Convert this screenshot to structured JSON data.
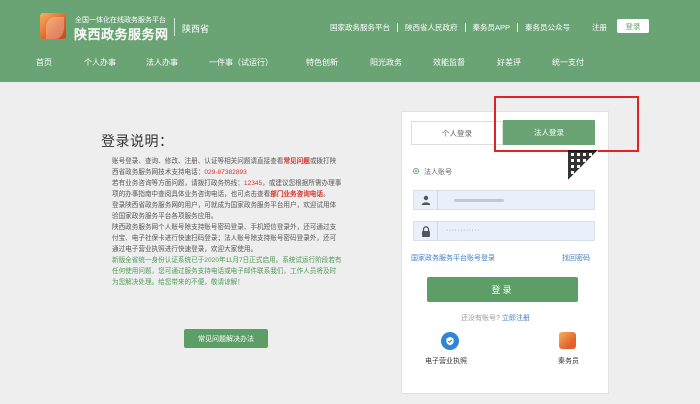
{
  "header": {
    "logo_small": "全国一体化在线政务服务平台",
    "logo_big": "陕西政务服务网",
    "province": "陕西省",
    "top_links": [
      "国家政务服务平台",
      "陕西省人民政府",
      "秦务员APP",
      "秦务员公众号"
    ],
    "register": "注册",
    "login": "登录",
    "brand_color": "#6aa374"
  },
  "nav": {
    "items": [
      "首页",
      "个人办事",
      "法人办事",
      "一件事（试运行）",
      "特色创新",
      "阳光政务",
      "效能监督",
      "好差评",
      "统一支付"
    ]
  },
  "intro": {
    "title": "登录说明：",
    "p1a": "账号登录、查询、修改、注册、认证等相关问题请直接查看",
    "p1b": "常见问题",
    "p1c": "或拨打陕西省政务服务网技术支持电话：",
    "p1d": "029-87382893",
    "p2a": "若有业务咨询等方面问题，请拨打政务热线：",
    "p2b": "12345",
    "p2c": "，或建议您根据所需办理事项的办事指南中查阅具体业务咨询电话，也可点击查看",
    "p2d": "部门业务咨询电话",
    "p2e": "。",
    "p3": "登录陕西省政务服务网的用户，可就成为国家政务服务平台用户，欢迎试用体验国家政务服务平台各项服务应用。",
    "p4": "陕西政务服务网个人账号除支持账号密码登录、手机短信登录外，还可通过支付宝、电子社保卡进行快速扫码登录；法人账号除支持账号密码登录外，还可通过电子营业执照进行快速登录，欢迎大家使用。",
    "p5": "新版全省统一身份认证系统已于2020年11月7日正式启用。系统试运行阶段若有任何使用问题，您可通过服务支持电话或电子邮件联系我们，工作人员将及时为您解决处理。给您带来的不便，敬请谅解！",
    "faq_button": "常见问题解决办法"
  },
  "login": {
    "tab_personal": "个人登录",
    "tab_legal": "法人登录",
    "radio_label": "法人账号",
    "account_value": "··········",
    "password_value": "············",
    "link_platform": "国家政务服务平台账号登录",
    "link_forgot": "找回密码",
    "submit": "登录",
    "no_account": "还没有账号?",
    "register": "立即注册",
    "alt_ebiz": "电子营业执照",
    "alt_qinwu": "秦务员"
  }
}
